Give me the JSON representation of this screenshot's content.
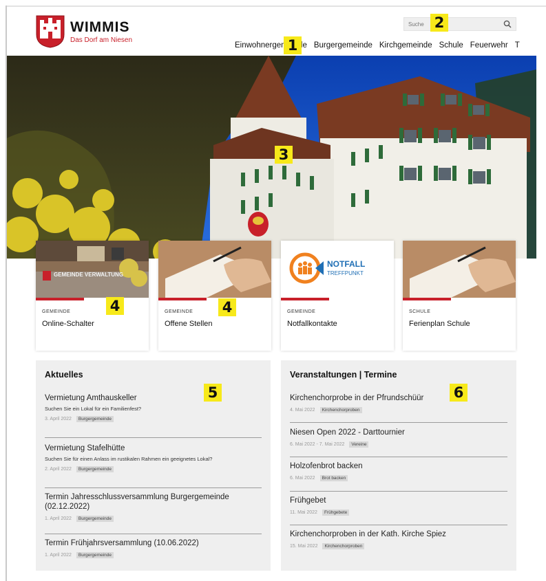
{
  "site": {
    "name": "WIMMIS",
    "tagline": "Das Dorf am Niesen"
  },
  "search": {
    "placeholder": "Suche",
    "icon": "search-icon"
  },
  "nav": {
    "items": [
      "Einwohnergemeinde",
      "Burgergemeinde",
      "Kirchgemeinde",
      "Schule",
      "Feuerwehr"
    ],
    "overflow": "T"
  },
  "cards": [
    {
      "category": "GEMEINDE",
      "title": "Online-Schalter",
      "image_text": "GEMEINDE VERWALTUNG"
    },
    {
      "category": "GEMEINDE",
      "title": "Offene Stellen"
    },
    {
      "category": "GEMEINDE",
      "title": "Notfallkontakte",
      "logo_text_1": "NOTFALL",
      "logo_text_2": "TREFFPUNKT"
    },
    {
      "category": "SCHULE",
      "title": "Ferienplan Schule"
    }
  ],
  "news": {
    "heading": "Aktuelles",
    "items": [
      {
        "title": "Vermietung Amthauskeller",
        "subtitle": "Suchen Sie ein Lokal für ein Familienfest?",
        "date": "3. April 2022",
        "tag": "Burgergemeinde"
      },
      {
        "title": "Vermietung Stafelhütte",
        "subtitle": "Suchen Sie für einen Anlass im rustikalen Rahmen ein geeignetes Lokal?",
        "date": "2. April 2022",
        "tag": "Burgergemeinde"
      },
      {
        "title": "Termin Jahresschlussversammlung Burgergemeinde (02.12.2022)",
        "subtitle": "",
        "date": "1. April 2022",
        "tag": "Burgergemeinde"
      },
      {
        "title": "Termin Frühjahrsversammlung (10.06.2022)",
        "subtitle": "",
        "date": "1. April 2022",
        "tag": "Burgergemeinde"
      }
    ]
  },
  "events": {
    "heading": "Veranstaltungen | Termine",
    "items": [
      {
        "title": "Kirchenchorprobe in der Pfrundschüür",
        "date": "4. Mai 2022",
        "tag": "Kirchenchorproben"
      },
      {
        "title": "Niesen Open 2022 - Darttournier",
        "date": "6. Mai 2022 - 7. Mai 2022",
        "tag": "Vereine"
      },
      {
        "title": "Holzofenbrot backen",
        "date": "6. Mai 2022",
        "tag": "Brot backen"
      },
      {
        "title": "Frühgebet",
        "date": "11. Mai 2022",
        "tag": "Frühgebete"
      },
      {
        "title": "Kirchenchorproben in der Kath. Kirche Spiez",
        "date": "15. Mai 2022",
        "tag": "Kirchenchorproben"
      }
    ]
  },
  "markers": [
    "1",
    "2",
    "3",
    "4",
    "4",
    "5",
    "6"
  ],
  "colors": {
    "brand_red": "#c8202a",
    "marker_yellow": "#f7e91a",
    "panel_bg": "#efefef",
    "notfall_blue": "#1f6fb5",
    "notfall_orange": "#f0811f"
  }
}
